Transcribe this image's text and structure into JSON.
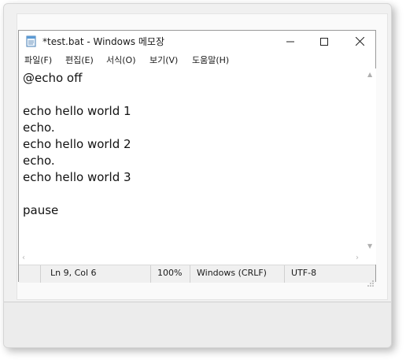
{
  "window": {
    "title": "*test.bat - Windows 메모장"
  },
  "menu": {
    "file": "파일(F)",
    "edit": "편집(E)",
    "format": "서식(O)",
    "view": "보기(V)",
    "help": "도움말(H)"
  },
  "editor": {
    "lines": [
      "@echo off",
      "",
      "echo hello world 1",
      "echo.",
      "echo hello world 2",
      "echo.",
      "echo hello world 3",
      "",
      "pause"
    ]
  },
  "status": {
    "position": "Ln 9, Col 6",
    "zoom": "100%",
    "line_ending": "Windows (CRLF)",
    "encoding": "UTF-8"
  },
  "icons": {
    "app": "notepad-icon",
    "minimize": "minimize-icon",
    "maximize": "maximize-icon",
    "close": "close-icon"
  },
  "colors": {
    "window_bg": "#ffffff",
    "statusbar_bg": "#f0f0f0",
    "text": "#111111"
  }
}
